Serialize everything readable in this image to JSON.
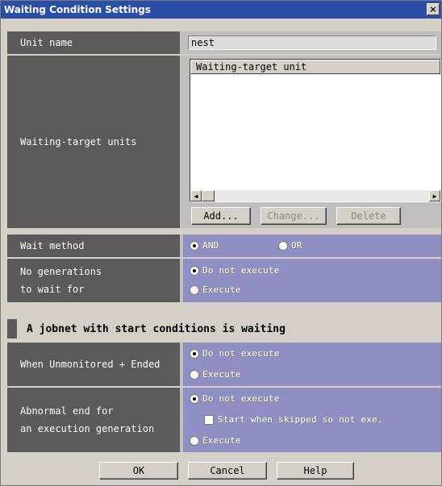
{
  "window": {
    "title": "Waiting Condition Settings",
    "close_glyph": "×"
  },
  "unit_name": {
    "label": "Unit name",
    "value": "nest"
  },
  "waiting_target_units": {
    "label": "Waiting-target units",
    "list_header": "Waiting-target unit",
    "items": [],
    "buttons": {
      "add": "Add...",
      "change": "Change...",
      "delete": "Delete"
    }
  },
  "wait_method": {
    "label": "Wait method",
    "options": [
      "AND",
      "OR"
    ],
    "selected": "AND"
  },
  "no_generations": {
    "label_line1": "No generations",
    "label_line2": "to wait for",
    "options": [
      "Do not execute",
      "Execute"
    ],
    "selected": "Do not execute"
  },
  "section": {
    "title": "A jobnet with start conditions is waiting"
  },
  "unmonitored_ended": {
    "label": "When Unmonitored + Ended",
    "options": [
      "Do not execute",
      "Execute"
    ],
    "selected": "Do not execute"
  },
  "abnormal_end": {
    "label_line1": "Abnormal end for",
    "label_line2": "an execution generation",
    "options": [
      "Do not execute",
      "Execute"
    ],
    "selected": "Do not execute",
    "checkbox_label": "Start when skipped so not exe.",
    "checkbox_checked": false
  },
  "footer": {
    "ok": "OK",
    "cancel": "Cancel",
    "help": "Help"
  }
}
